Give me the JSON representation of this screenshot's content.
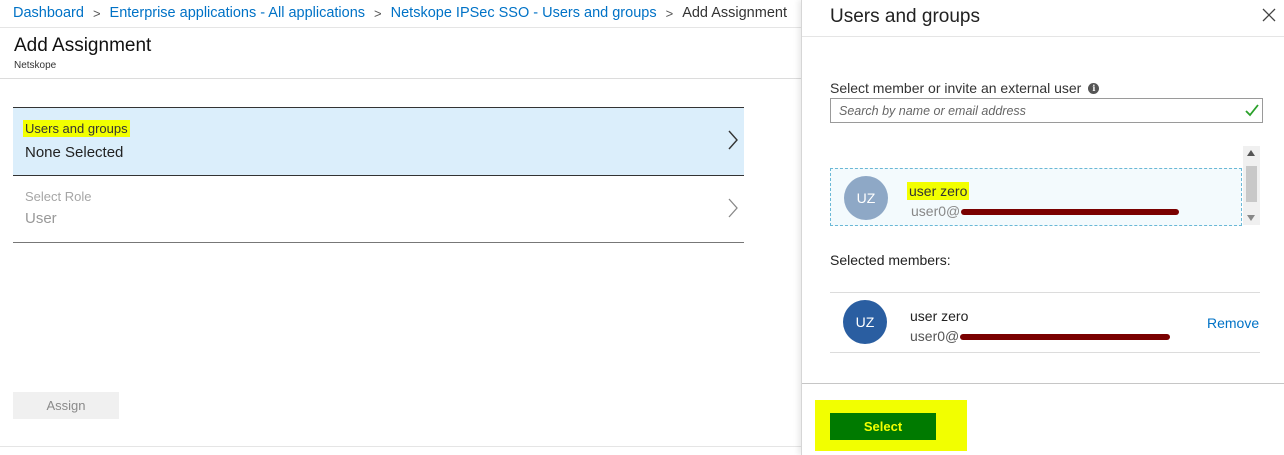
{
  "breadcrumb": {
    "items": [
      "Dashboard",
      "Enterprise applications - All applications",
      "Netskope IPSec SSO - Users and groups"
    ],
    "current": "Add Assignment",
    "separator": ">"
  },
  "blade": {
    "title": "Add Assignment",
    "subtitle": "Netskope",
    "users_row": {
      "label": "Users and groups",
      "value": "None Selected"
    },
    "role_row": {
      "label": "Select Role",
      "value": "User"
    },
    "assign_label": "Assign"
  },
  "panel": {
    "title": "Users and groups",
    "search_label": "Select member or invite an external user",
    "info_icon": "i",
    "search_placeholder": "Search by name or email address",
    "search_value": "",
    "result": {
      "initials": "UZ",
      "name": "user zero",
      "email_prefix": "user0@"
    },
    "selected_label": "Selected members:",
    "member": {
      "initials": "UZ",
      "name": "user zero",
      "email_prefix": "user0@",
      "remove_label": "Remove"
    },
    "select_label": "Select"
  },
  "colors": {
    "link": "#0072c6",
    "highlight": "#f2ff00",
    "select_button": "#007a00",
    "row_selected_bg": "#dbeefb",
    "avatar_light": "#8ea8c6",
    "avatar_dark": "#2a5ea1",
    "redaction": "#7a0000"
  },
  "icons": [
    "chevron-right-icon",
    "close-icon",
    "info-icon",
    "checkmark-icon",
    "scroll-up-arrow-icon",
    "scroll-down-arrow-icon"
  ]
}
